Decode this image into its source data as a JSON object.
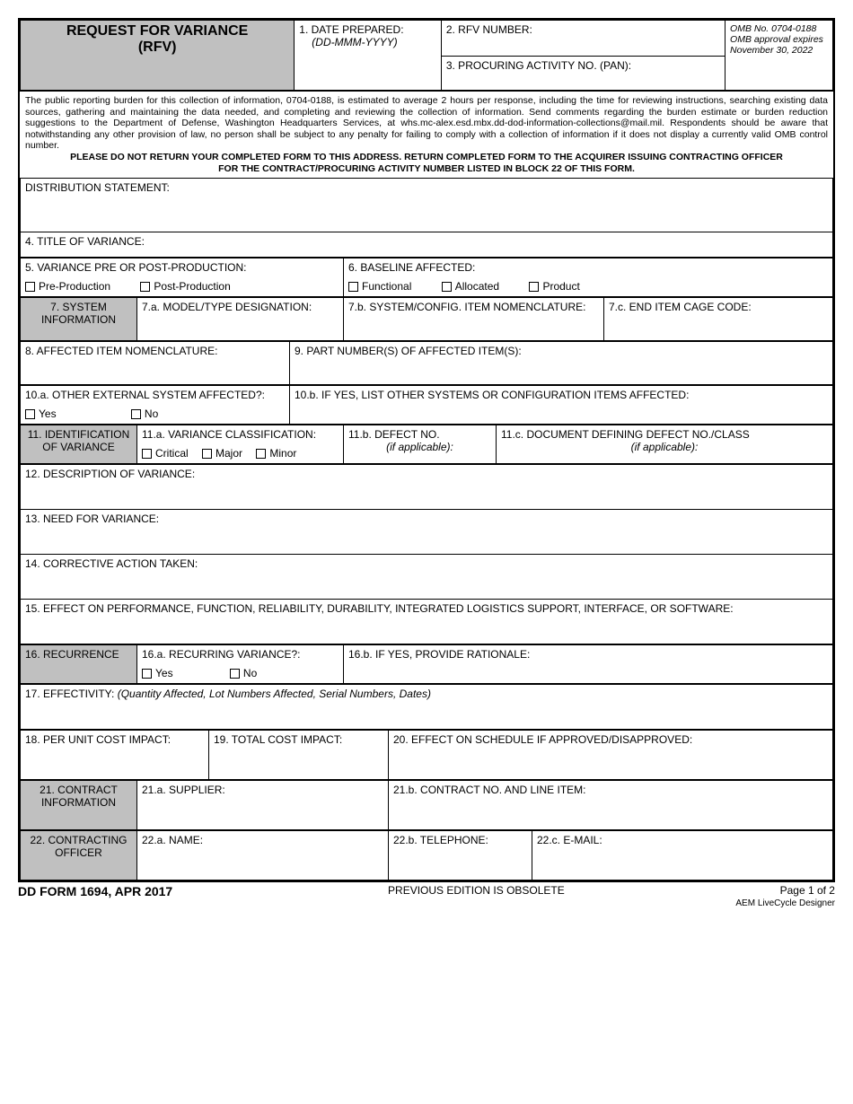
{
  "title": {
    "line1": "REQUEST FOR VARIANCE",
    "line2": "(RFV)"
  },
  "top": {
    "box1_label": "1.  DATE PREPARED:",
    "box1_sub": "(DD-MMM-YYYY)",
    "box2_label": "2.  RFV NUMBER:",
    "box3_label": "3.  PROCURING ACTIVITY NO. (PAN):",
    "omb_no": "OMB No. 0704-0188",
    "omb_expires": "OMB approval expires",
    "omb_date": "November 30, 2022"
  },
  "burden_text": "The public reporting burden for this collection of information, 0704-0188, is estimated to average 2 hours per response, including the time for reviewing instructions, searching existing data sources, gathering and maintaining the data needed, and completing and reviewing the collection of information. Send comments regarding the burden estimate or burden reduction suggestions to the Department of Defense, Washington Headquarters Services, at whs.mc-alex.esd.mbx.dd-dod-information-collections@mail.mil. Respondents should be aware that notwithstanding any other provision of law, no person shall be subject to any penalty for failing to comply with a collection of information if it does not display a currently valid OMB control number.",
  "burden_bold1": "PLEASE DO NOT RETURN YOUR COMPLETED FORM TO THIS ADDRESS. RETURN COMPLETED FORM TO THE ACQUIRER ISSUING CONTRACTING OFFICER",
  "burden_bold2": "FOR THE CONTRACT/PROCURING ACTIVITY NUMBER LISTED IN BLOCK 22 OF THIS FORM.",
  "dist_label": "DISTRIBUTION STATEMENT:",
  "b4": "4.  TITLE OF VARIANCE:",
  "b5": {
    "label": "5.  VARIANCE PRE OR POST-PRODUCTION:",
    "opt1": "Pre-Production",
    "opt2": "Post-Production"
  },
  "b6": {
    "label": "6.  BASELINE AFFECTED:",
    "opt1": "Functional",
    "opt2": "Allocated",
    "opt3": "Product"
  },
  "b7": {
    "heading": "7.  SYSTEM INFORMATION",
    "a": "7.a.  MODEL/TYPE DESIGNATION:",
    "b": "7.b.  SYSTEM/CONFIG. ITEM NOMENCLATURE:",
    "c": "7.c.  END ITEM CAGE CODE:"
  },
  "b8": "8.  AFFECTED ITEM NOMENCLATURE:",
  "b9": "9.  PART NUMBER(S) OF AFFECTED ITEM(S):",
  "b10": {
    "a": "10.a.  OTHER EXTERNAL SYSTEM AFFECTED?:",
    "b": "10.b. IF YES, LIST OTHER SYSTEMS OR CONFIGURATION ITEMS AFFECTED:",
    "yes": "Yes",
    "no": "No"
  },
  "b11": {
    "heading": "11.  IDENTIFICATION OF VARIANCE",
    "a": "11.a.  VARIANCE CLASSIFICATION:",
    "b_label": "11.b.  DEFECT NO.",
    "b_sub": "(if applicable):",
    "c_label": "11.c.  DOCUMENT DEFINING DEFECT NO./CLASS",
    "c_sub": "(if applicable):",
    "opt1": "Critical",
    "opt2": "Major",
    "opt3": "Minor"
  },
  "b12": "12.  DESCRIPTION OF VARIANCE:",
  "b13": "13.  NEED FOR VARIANCE:",
  "b14": "14.  CORRECTIVE ACTION TAKEN:",
  "b15": "15.  EFFECT ON PERFORMANCE, FUNCTION, RELIABILITY, DURABILITY, INTEGRATED LOGISTICS SUPPORT, INTERFACE, OR SOFTWARE:",
  "b16": {
    "heading": "16.  RECURRENCE",
    "a": "16.a.  RECURRING VARIANCE?:",
    "b": "16.b.  IF YES, PROVIDE RATIONALE:",
    "yes": "Yes",
    "no": "No"
  },
  "b17": {
    "label": "17.  EFFECTIVITY:",
    "sub": "(Quantity Affected, Lot Numbers Affected, Serial Numbers, Dates)"
  },
  "b18": "18.  PER UNIT COST IMPACT:",
  "b19": "19.  TOTAL COST IMPACT:",
  "b20": "20.  EFFECT ON SCHEDULE IF APPROVED/DISAPPROVED:",
  "b21": {
    "heading": "21.  CONTRACT INFORMATION",
    "a": "21.a.  SUPPLIER:",
    "b": "21.b.  CONTRACT NO. AND LINE ITEM:"
  },
  "b22": {
    "heading": "22.  CONTRACTING OFFICER",
    "a": "22.a.  NAME:",
    "b": "22.b.  TELEPHONE:",
    "c": "22.c.  E-MAIL:"
  },
  "footer": {
    "form_id": "DD FORM 1694, APR 2017",
    "obsolete": "PREVIOUS EDITION IS OBSOLETE",
    "page": "Page 1 of 2",
    "designer": "AEM LiveCycle Designer"
  }
}
